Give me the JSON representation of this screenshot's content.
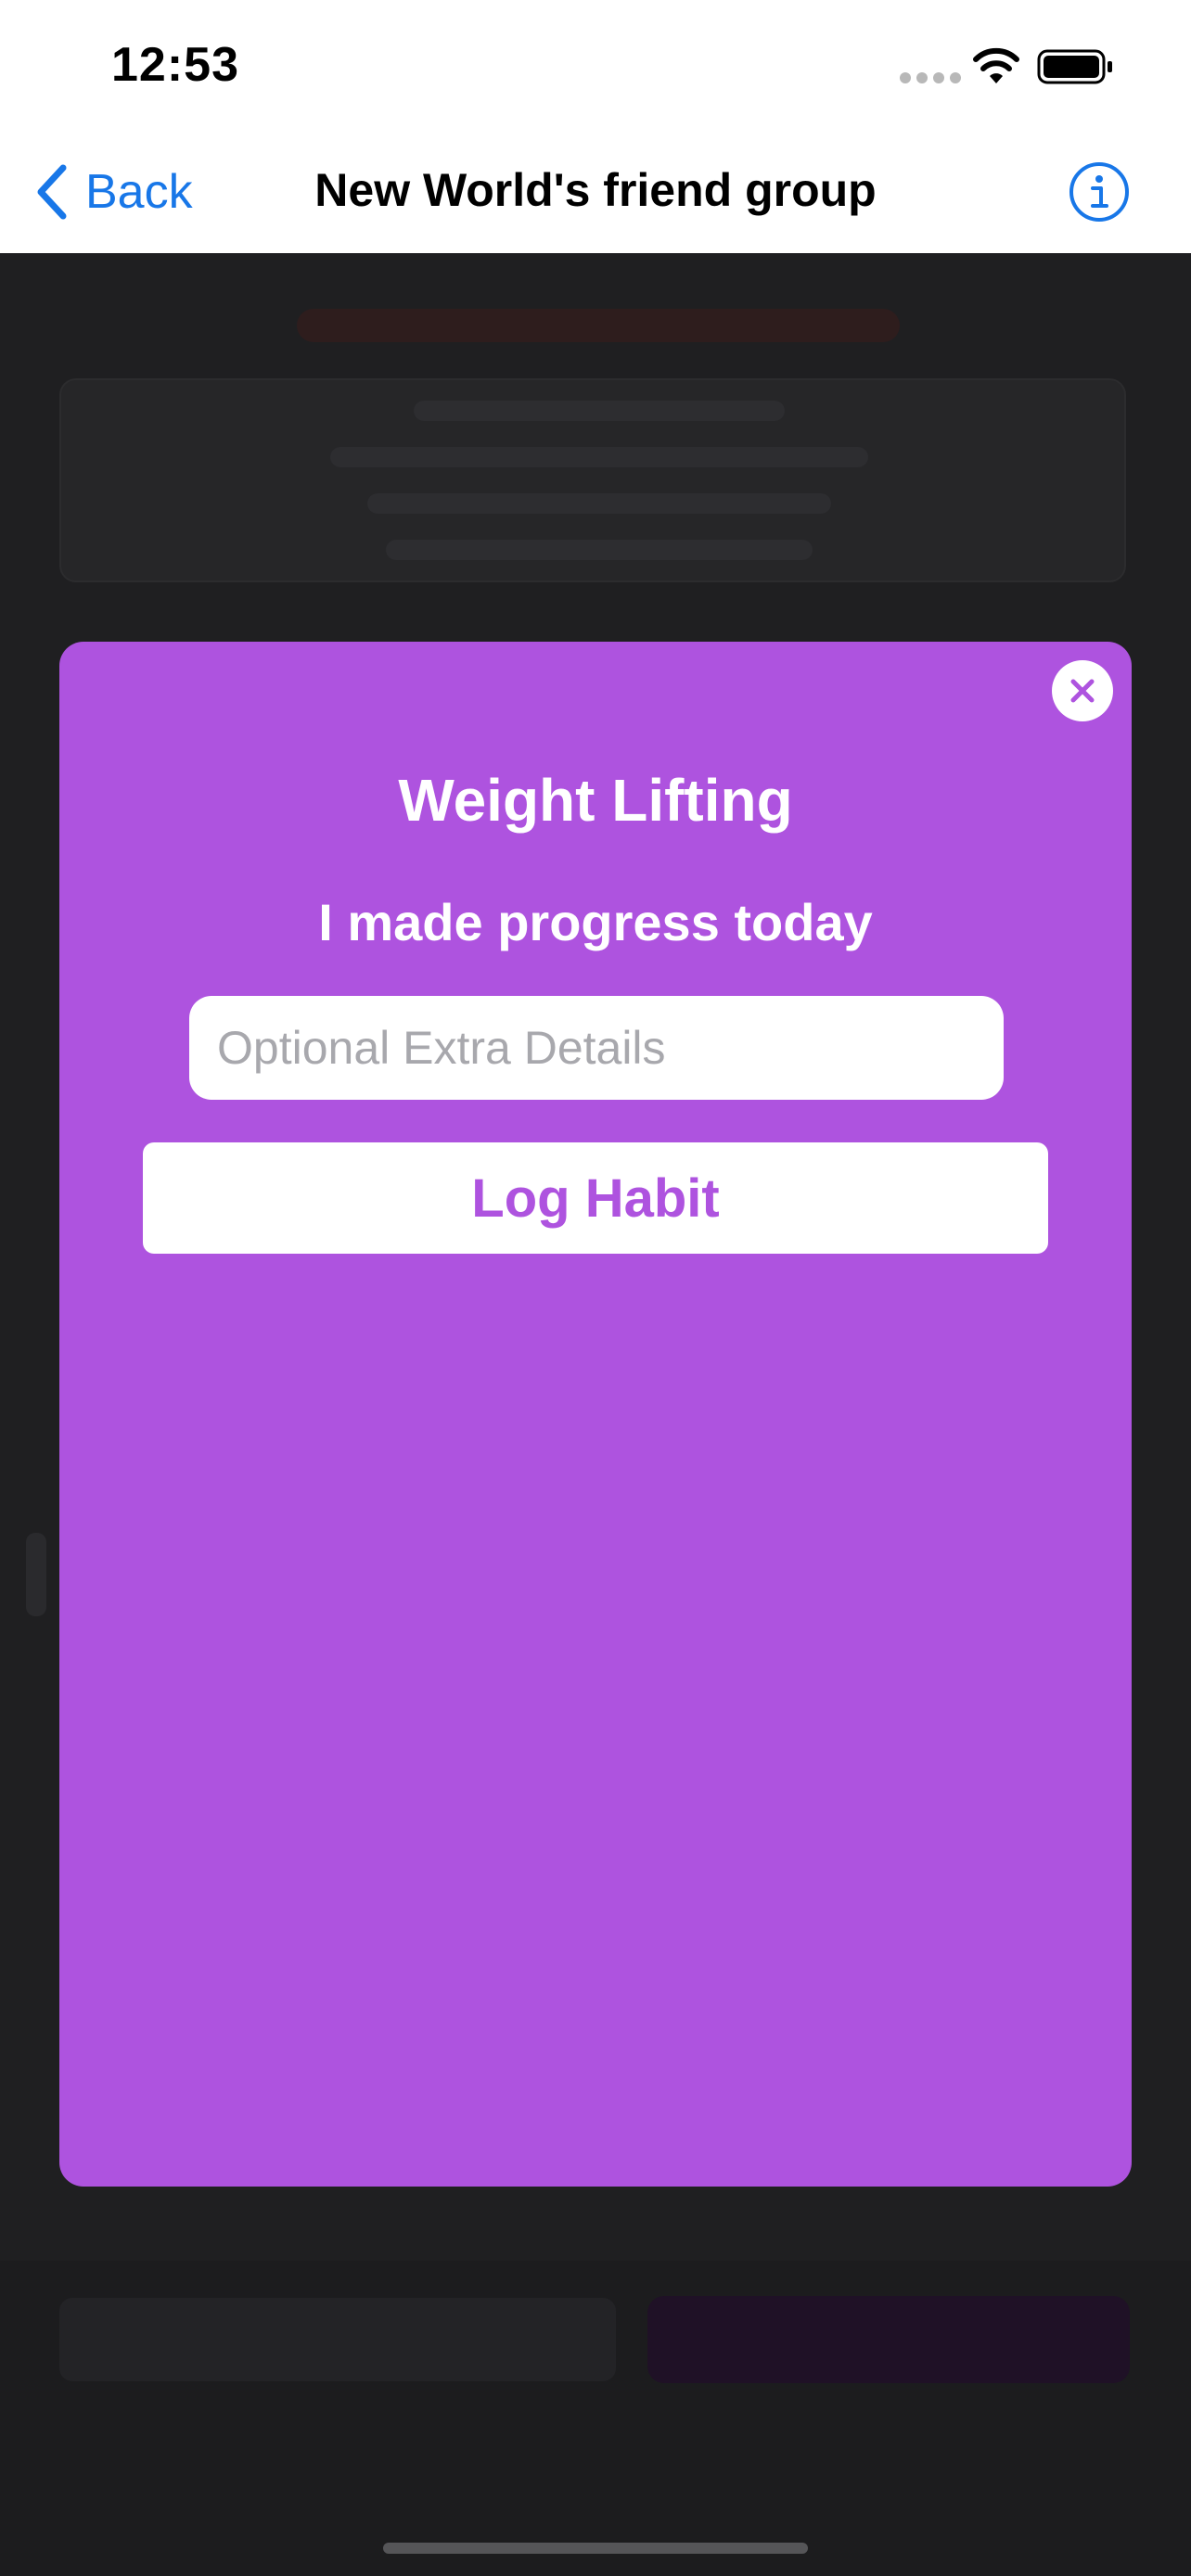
{
  "status_bar": {
    "time": "12:53",
    "icons": [
      "signal-icon",
      "wifi-icon",
      "battery-icon"
    ]
  },
  "nav": {
    "back_label": "Back",
    "title": "New World's friend group",
    "info_icon": "info-icon"
  },
  "modal": {
    "title": "Weight Lifting",
    "subtitle": "I made progress today",
    "details_placeholder": "Optional Extra Details",
    "details_value": "",
    "log_button_label": "Log Habit",
    "close_icon": "close-icon"
  },
  "colors": {
    "accent_blue": "#1877e8",
    "modal_purple": "#ae53df",
    "overlay_dark": "#1f1f21"
  }
}
